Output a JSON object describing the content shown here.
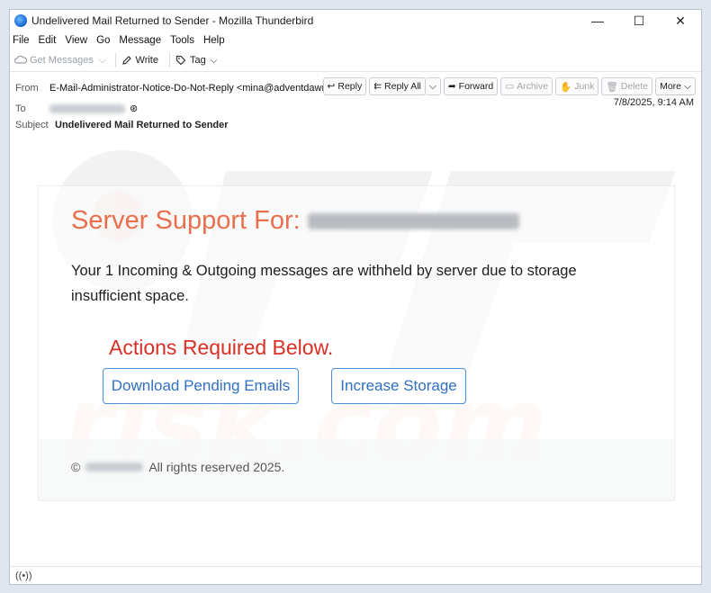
{
  "window": {
    "title": "Undelivered Mail Returned to Sender - Mozilla Thunderbird",
    "controls": {
      "minimize": "—",
      "maximize": "☐",
      "close": "✕"
    }
  },
  "menu": [
    "File",
    "Edit",
    "View",
    "Go",
    "Message",
    "Tools",
    "Help"
  ],
  "toolbar": {
    "get_messages": "Get Messages",
    "write": "Write",
    "tag": "Tag"
  },
  "header": {
    "from_label": "From",
    "from_value": "E-Mail-Administrator-Notice-Do-Not-Reply <mina@adventdawn.com>",
    "to_label": "To",
    "subject_label": "Subject",
    "subject_value": "Undelivered Mail Returned to Sender",
    "date": "7/8/2025, 9:14 AM",
    "buttons": {
      "reply": "Reply",
      "reply_all": "Reply All",
      "forward": "Forward",
      "archive": "Archive",
      "junk": "Junk",
      "delete": "Delete",
      "more": "More"
    }
  },
  "email": {
    "heading": "Server Support For:",
    "message": "Your 1 Incoming & Outgoing messages are withheld by server  due to storage insufficient space.",
    "actions_title": "Actions Required Below.",
    "button_download": "Download Pending Emails",
    "button_storage": "Increase Storage",
    "footer_copyright": "©",
    "footer_rights": "All rights reserved 2025."
  },
  "colors": {
    "heading": "#e8704f",
    "actions": "#d93025",
    "button_border": "#4a8edc",
    "button_text": "#2f6fc4"
  }
}
